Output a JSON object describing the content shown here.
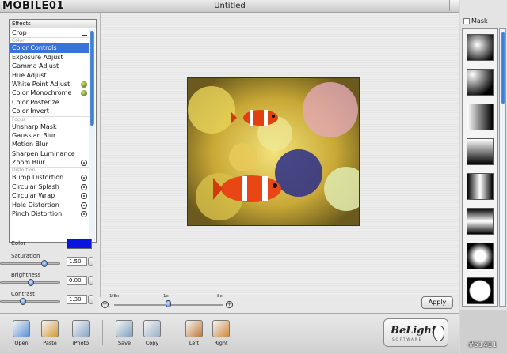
{
  "watermark": {
    "logo": "MOBILE01",
    "id": "#51411"
  },
  "window": {
    "title": "Untitled"
  },
  "effects": {
    "header": "Effects",
    "items": [
      {
        "label": "Crop",
        "kind": "item",
        "icon": "crop"
      },
      {
        "label": "Color",
        "kind": "group"
      },
      {
        "label": "Color Controls",
        "kind": "item",
        "selected": true
      },
      {
        "label": "Exposure Adjust",
        "kind": "item"
      },
      {
        "label": "Gamma Adjust",
        "kind": "item"
      },
      {
        "label": "Hue Adjust",
        "kind": "item"
      },
      {
        "label": "White Point Adjust",
        "kind": "item",
        "icon": "globe"
      },
      {
        "label": "Color Monochrome",
        "kind": "item",
        "icon": "globe"
      },
      {
        "label": "Color Posterize",
        "kind": "item"
      },
      {
        "label": "Color Invert",
        "kind": "item"
      },
      {
        "label": "Focus",
        "kind": "group"
      },
      {
        "label": "Unsharp Mask",
        "kind": "item"
      },
      {
        "label": "Gaussian Blur",
        "kind": "item"
      },
      {
        "label": "Motion Blur",
        "kind": "item"
      },
      {
        "label": "Sharpen Luminance",
        "kind": "item"
      },
      {
        "label": "Zoom Blur",
        "kind": "item",
        "icon": "target"
      },
      {
        "label": "Distortion",
        "kind": "group"
      },
      {
        "label": "Bump Distortion",
        "kind": "item",
        "icon": "target"
      },
      {
        "label": "Circular Splash",
        "kind": "item",
        "icon": "target"
      },
      {
        "label": "Circular Wrap",
        "kind": "item",
        "icon": "target"
      },
      {
        "label": "Hole Distortion",
        "kind": "item",
        "icon": "target"
      },
      {
        "label": "Pinch Distortion",
        "kind": "item",
        "icon": "target"
      }
    ]
  },
  "properties": {
    "color_label": "Color",
    "color_value": "#0a14e0",
    "saturation": {
      "label": "Saturation",
      "value": "1.50",
      "level": 0.75
    },
    "brightness": {
      "label": "Brightness",
      "value": "0.00",
      "level": 0.5
    },
    "contrast": {
      "label": "Contrast",
      "value": "1.30",
      "level": 0.35
    }
  },
  "zoom": {
    "min_label": "1/8x",
    "mid_label": "1x",
    "max_label": "8x",
    "level": 0.5
  },
  "apply_label": "Apply",
  "toolbar": {
    "buttons": [
      {
        "label": "Open",
        "icon": "open-icon"
      },
      {
        "label": "Paste",
        "icon": "paste-icon"
      },
      {
        "label": "iPhoto",
        "icon": "iphoto-icon"
      },
      {
        "label": "Save",
        "icon": "save-icon"
      },
      {
        "label": "Copy",
        "icon": "copy-icon"
      },
      {
        "label": "Left",
        "icon": "rotate-left-icon"
      },
      {
        "label": "Right",
        "icon": "rotate-right-icon"
      }
    ],
    "logo_text": "BeLight",
    "logo_sub": "SOFTWARE"
  },
  "mask": {
    "label": "Mask",
    "checked": false,
    "tiles": [
      "radial-soft",
      "radial-corner",
      "linear-lr",
      "linear-tb",
      "bar-vertical",
      "bar-horizontal",
      "radial-center",
      "star-burst"
    ]
  }
}
